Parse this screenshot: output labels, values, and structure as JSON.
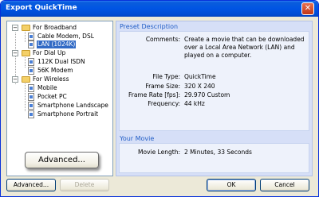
{
  "window": {
    "title": "Export QuickTime",
    "close_symbol": "✕"
  },
  "tree": {
    "items": [
      {
        "label": "For Broadband",
        "kind": "folder",
        "expander": "−"
      },
      {
        "label": "Cable Modem, DSL",
        "kind": "preset"
      },
      {
        "label": "LAN (1024K)",
        "kind": "preset",
        "selected": true
      },
      {
        "label": "For Dial Up",
        "kind": "folder",
        "expander": "−"
      },
      {
        "label": "112K Dual ISDN",
        "kind": "preset"
      },
      {
        "label": "56K Modem",
        "kind": "preset"
      },
      {
        "label": "For Wireless",
        "kind": "folder",
        "expander": "−"
      },
      {
        "label": "Mobile",
        "kind": "preset"
      },
      {
        "label": "Pocket PC",
        "kind": "preset"
      },
      {
        "label": "Smartphone Landscape",
        "kind": "preset"
      },
      {
        "label": "Smartphone Portrait",
        "kind": "preset"
      }
    ]
  },
  "preset_description": {
    "title": "Preset Description",
    "comments_label": "Comments:",
    "comments_value": "Create a movie that can be downloaded over a Local Area Network (LAN) and played on a computer.",
    "file_type_label": "File Type:",
    "file_type_value": "QuickTime",
    "frame_size_label": "Frame Size:",
    "frame_size_value": "320 X 240",
    "frame_rate_label": "Frame Rate [fps]:",
    "frame_rate_value": "29.970 Custom",
    "frequency_label": "Frequency:",
    "frequency_value": "44 kHz"
  },
  "your_movie": {
    "title": "Your Movie",
    "length_label": "Movie Length:",
    "length_value": "2 Minutes, 33 Seconds"
  },
  "buttons": {
    "advanced": "Advanced...",
    "delete": "Delete",
    "ok": "OK",
    "cancel": "Cancel"
  },
  "callout": {
    "label": "Advanced..."
  },
  "colors": {
    "title_bar": "#0054e3",
    "selection": "#316ac5",
    "section_title": "#215dc6",
    "panel": "#d6dff7"
  }
}
